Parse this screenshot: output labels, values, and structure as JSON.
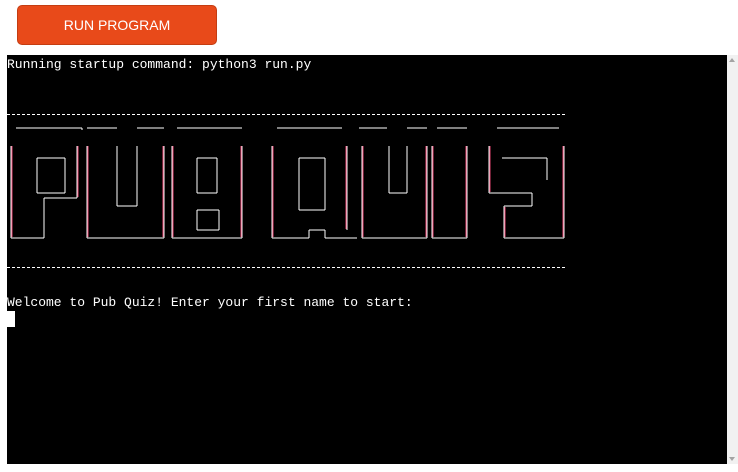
{
  "toolbar": {
    "run_label": "RUN PROGRAM"
  },
  "terminal": {
    "startup_line": "Running startup command: python3 run.py",
    "banner_text": "PUB QUIZ",
    "prompt": "Welcome to Pub Quiz! Enter your first name to start:",
    "input_value": ""
  },
  "colors": {
    "button": "#e84a1a",
    "terminal_bg": "#000000",
    "terminal_fg": "#ffffff",
    "banner_edge": "#ff4b7d"
  }
}
